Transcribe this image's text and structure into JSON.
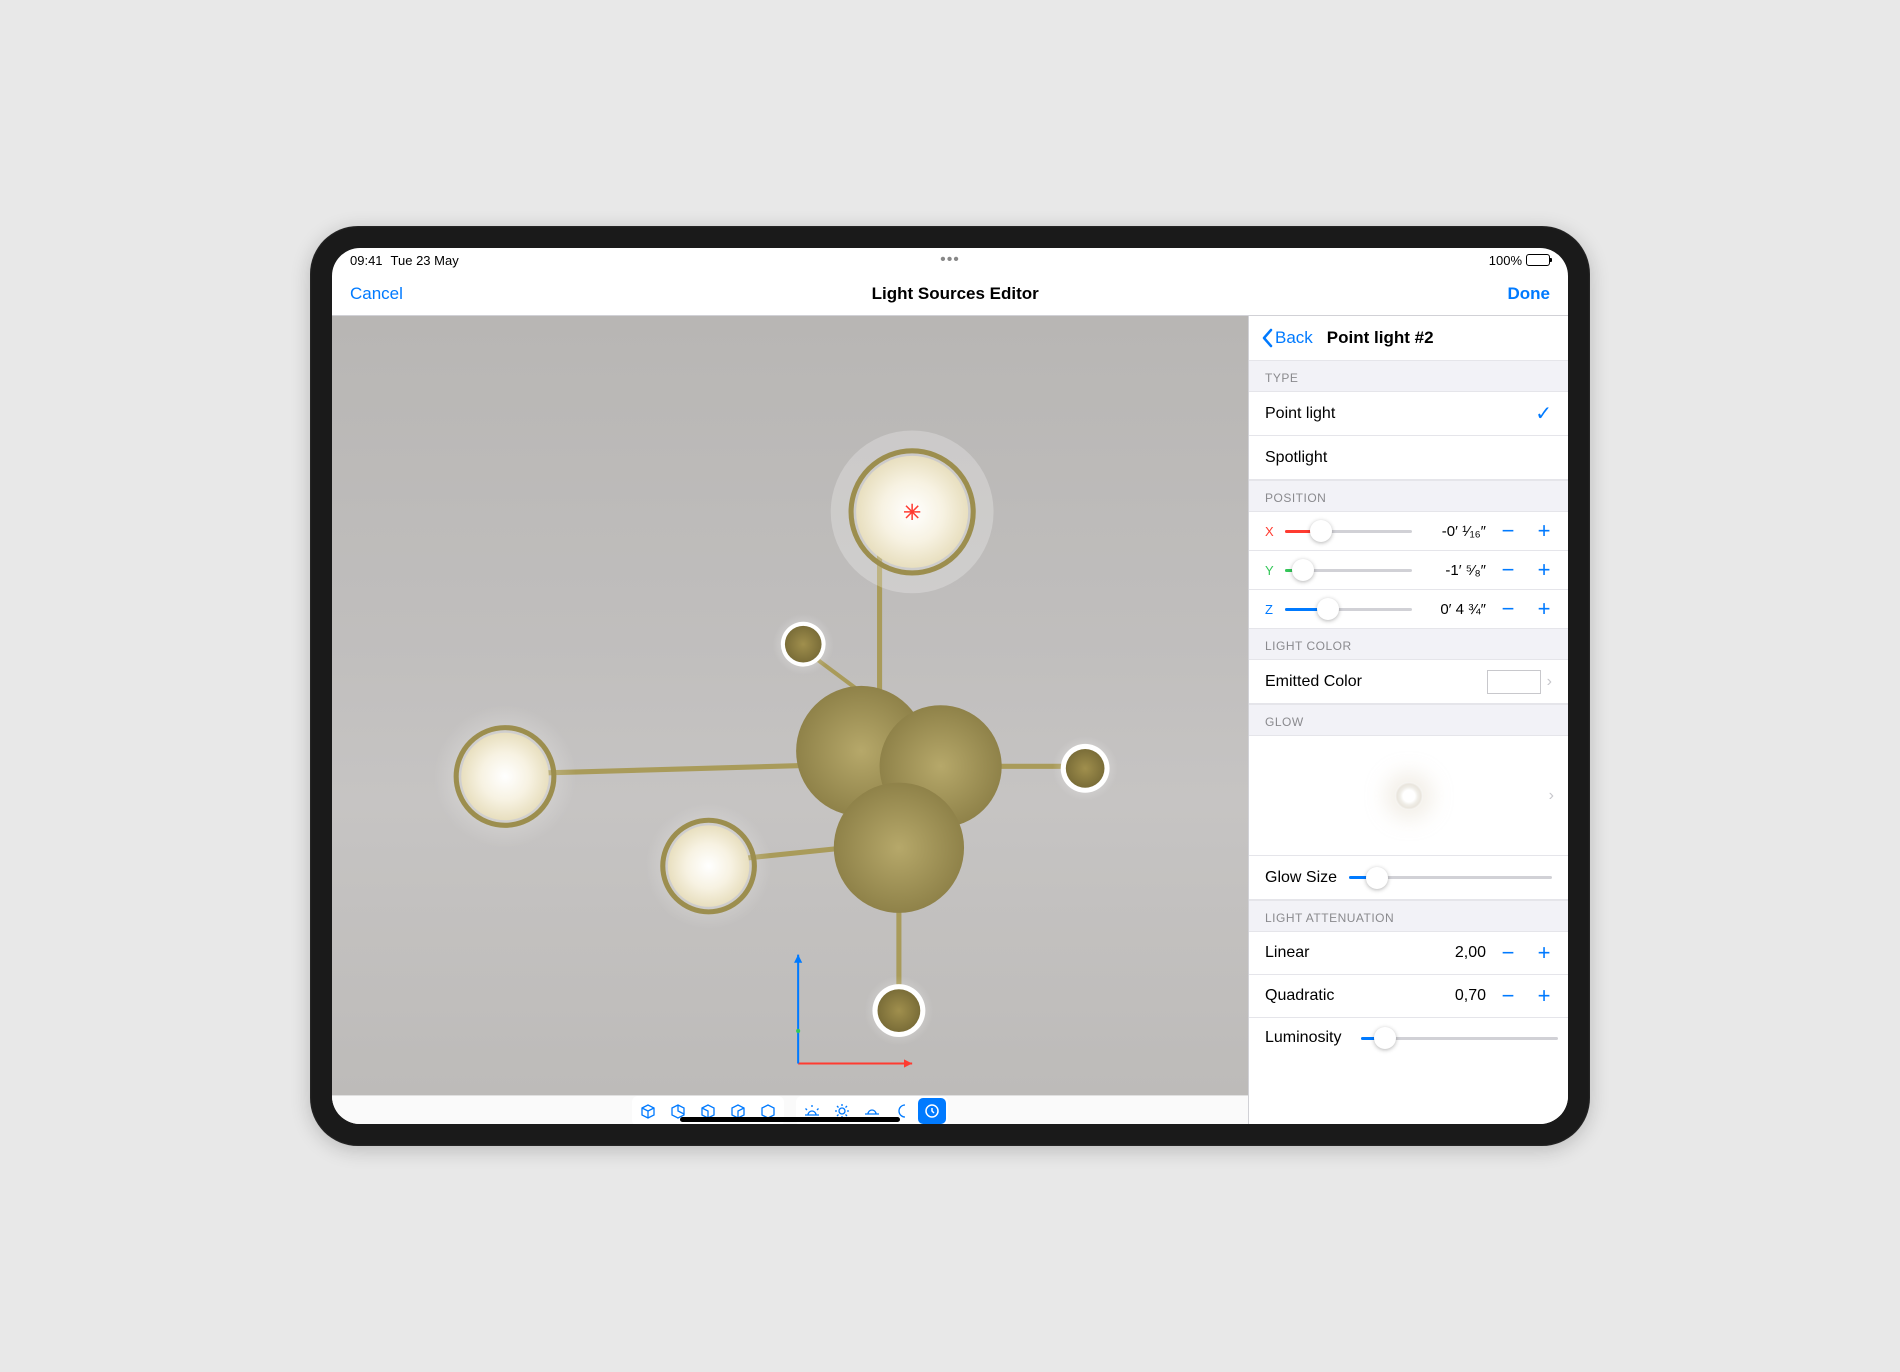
{
  "status": {
    "time": "09:41",
    "date": "Tue 23 May",
    "battery_pct": "100%"
  },
  "nav": {
    "cancel": "Cancel",
    "title": "Light Sources Editor",
    "done": "Done"
  },
  "panel": {
    "back": "Back",
    "title": "Point light #2",
    "sections": {
      "type": "TYPE",
      "position": "POSITION",
      "light_color": "LIGHT COLOR",
      "glow": "GLOW",
      "attenuation": "LIGHT ATTENUATION"
    },
    "type_options": {
      "point": "Point light",
      "spot": "Spotlight",
      "selected": "point"
    },
    "position": {
      "x": {
        "label": "X",
        "value": "-0′ ¹⁄₁₆″",
        "color": "#ff3b30",
        "pct": 28
      },
      "y": {
        "label": "Y",
        "value": "-1′ ⁵⁄₈″",
        "color": "#34c759",
        "pct": 14
      },
      "z": {
        "label": "Z",
        "value": "0′ 4 ¾″",
        "color": "#007aff",
        "pct": 34
      }
    },
    "emitted_color": {
      "label": "Emitted Color",
      "hex": "#ffffff"
    },
    "glow_size": {
      "label": "Glow Size",
      "pct": 14
    },
    "attenuation": {
      "linear": {
        "label": "Linear",
        "value": "2,00"
      },
      "quadratic": {
        "label": "Quadratic",
        "value": "0,70"
      },
      "luminosity": {
        "label": "Luminosity",
        "pct": 12
      }
    }
  }
}
